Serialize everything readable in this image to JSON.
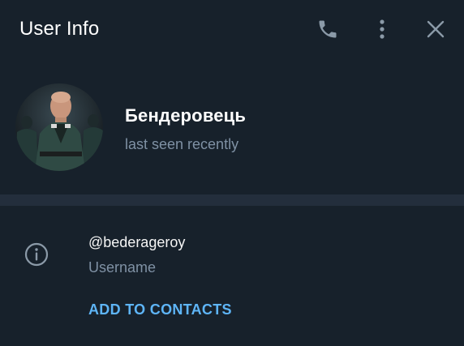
{
  "header": {
    "title": "User Info",
    "call_icon": "phone-icon",
    "menu_icon": "more-vertical-icon",
    "close_icon": "close-icon"
  },
  "profile": {
    "name": "Бендеровець",
    "status": "last seen recently"
  },
  "info": {
    "icon": "info-icon",
    "username": "@bederageroy",
    "username_caption": "Username"
  },
  "actions": {
    "add_contacts": "ADD TO CONTACTS"
  },
  "colors": {
    "background": "#17212b",
    "divider": "#232e3c",
    "secondary_text": "#7f91a4",
    "accent": "#5eb5f7",
    "icon": "#8b9aa8"
  }
}
